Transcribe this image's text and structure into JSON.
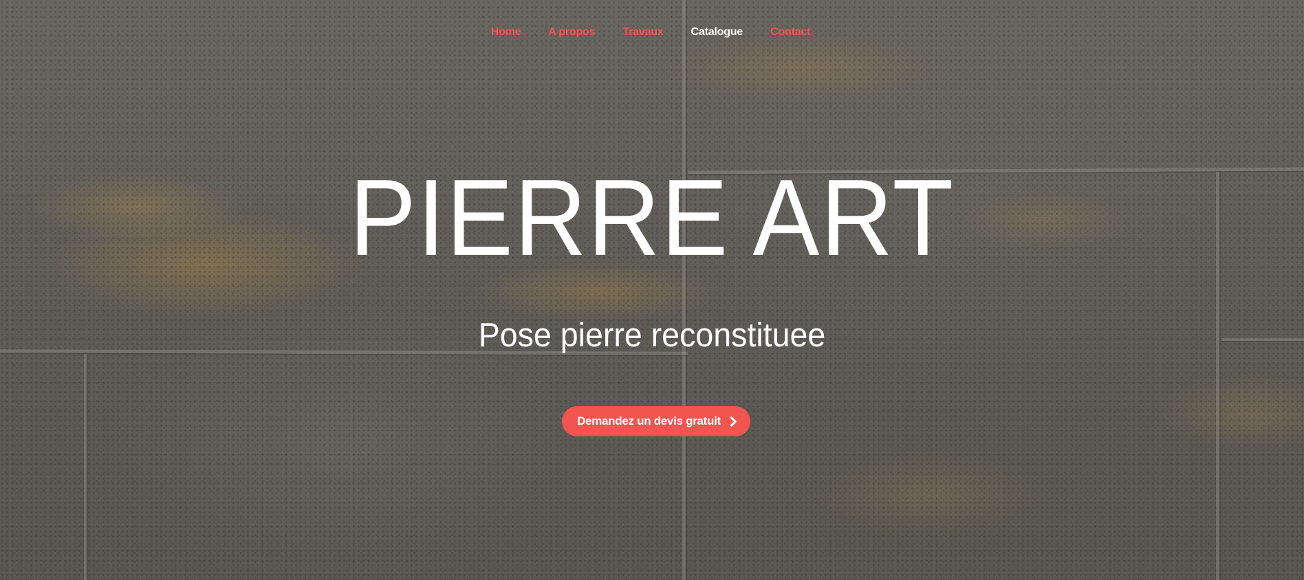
{
  "nav": {
    "items": [
      {
        "label": "Home",
        "active": false
      },
      {
        "label": "A propos",
        "active": false
      },
      {
        "label": "Travaux",
        "active": false
      },
      {
        "label": "Catalogue",
        "active": true
      },
      {
        "label": "Contact",
        "active": false
      }
    ]
  },
  "hero": {
    "title": "PIERRE ART",
    "subtitle": "Pose pierre reconstituee",
    "cta_label": "Demandez un devis gratuit",
    "cta_icon": "chevron-right-icon"
  },
  "colors": {
    "accent": "#f2544f",
    "text": "#ffffff"
  }
}
